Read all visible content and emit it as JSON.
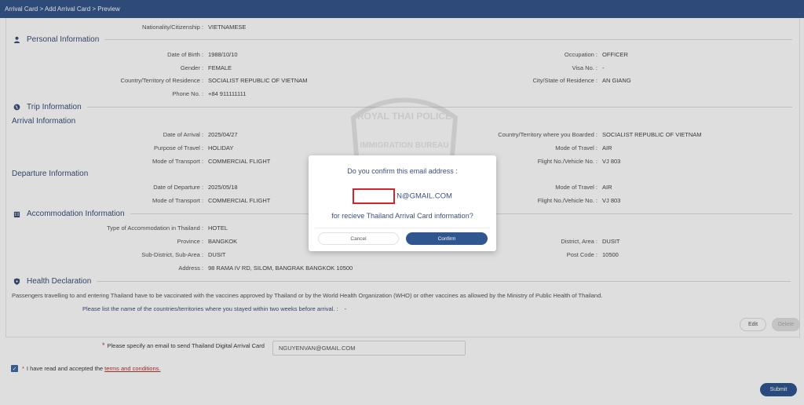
{
  "breadcrumb": "Arrival Card > Add Arrival Card > Preview",
  "top_field": {
    "label": "Nationality/Citizenship :",
    "value": "VIETNAMESE"
  },
  "personal": {
    "title": "Personal Information",
    "left": [
      {
        "label": "Date of Birth :",
        "value": "1988/10/10"
      },
      {
        "label": "Gender :",
        "value": "FEMALE"
      },
      {
        "label": "Country/Territory of Residence :",
        "value": "SOCIALIST REPUBLIC OF VIETNAM"
      },
      {
        "label": "Phone No. :",
        "value": "+84 911111111"
      }
    ],
    "right": [
      {
        "label": "Occupation :",
        "value": "OFFICER"
      },
      {
        "label": "Visa No. :",
        "value": "-"
      },
      {
        "label": "City/State of Residence :",
        "value": "AN GIANG"
      }
    ]
  },
  "trip": {
    "title": "Trip Information",
    "arrival_title": "Arrival Information",
    "arrival_left": [
      {
        "label": "Date of Arrival :",
        "value": "2025/04/27"
      },
      {
        "label": "Purpose of Travel :",
        "value": "HOLIDAY"
      },
      {
        "label": "Mode of Transport :",
        "value": "COMMERCIAL FLIGHT"
      }
    ],
    "arrival_right": [
      {
        "label": "Country/Territory where you Boarded :",
        "value": "SOCIALIST REPUBLIC OF VIETNAM"
      },
      {
        "label": "Mode of Travel :",
        "value": "AIR"
      },
      {
        "label": "Flight No./Vehicle No. :",
        "value": "VJ 803"
      }
    ],
    "departure_title": "Departure Information",
    "departure_left": [
      {
        "label": "Date of Departure :",
        "value": "2025/05/18"
      },
      {
        "label": "Mode of Transport :",
        "value": "COMMERCIAL FLIGHT"
      }
    ],
    "departure_right": [
      {
        "label": "Mode of Travel :",
        "value": "AIR"
      },
      {
        "label": "Flight No./Vehicle No. :",
        "value": "VJ 803"
      }
    ]
  },
  "accommodation": {
    "title": "Accommodation Information",
    "left": [
      {
        "label": "Type of Accommodation in Thailand :",
        "value": "HOTEL"
      },
      {
        "label": "Province :",
        "value": "BANGKOK"
      },
      {
        "label": "Sub-District, Sub-Area :",
        "value": "DUSIT"
      },
      {
        "label": "Address :",
        "value": "98 RAMA IV RD, SILOM, BANGRAK BANGKOK 10500"
      }
    ],
    "right": [
      {
        "label": "District, Area :",
        "value": "DUSIT"
      },
      {
        "label": "Post Code :",
        "value": "10500"
      }
    ]
  },
  "health": {
    "title": "Health Declaration",
    "note": "Passengers travelling to and entering Thailand have to be vaccinated with the vaccines approved by Thailand or by the World Health Organization (WHO) or other vaccines as allowed by the Ministry of Public Health of Thailand.",
    "countries_label": "Please list the name of the countries/territories where you stayed within two weeks before arrival. :",
    "countries_value": "-"
  },
  "actions": {
    "edit": "Edit",
    "delete": "Delete",
    "submit": "Submit"
  },
  "email": {
    "required_mark": "*",
    "label": "Please specify an email to send Thailand Digital Arrival Card",
    "value": "NGUYENVAN@GMAIL.COM"
  },
  "terms": {
    "required_mark": "*",
    "text": "I have read and accepted the",
    "link": "terms and conditions."
  },
  "watermark": {
    "line1": "ROYAL THAI POLICE",
    "line2": "IMMIGRATION BUREAU"
  },
  "modal": {
    "question": "Do you confirm this email address :",
    "email_visible": "N@GMAIL.COM",
    "purpose": "for recieve Thailand Arrival Card information?",
    "cancel": "Cancel",
    "confirm": "Confirm"
  },
  "colors": {
    "header": "#34558b",
    "accent": "#2f568f",
    "heading": "#3c4f79",
    "highlight": "#d6232a"
  }
}
